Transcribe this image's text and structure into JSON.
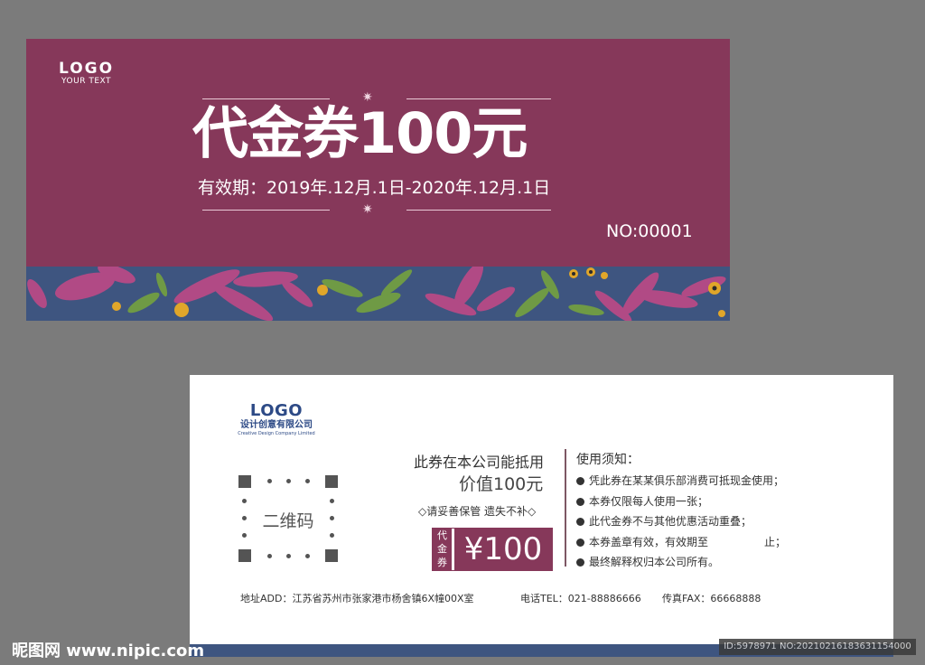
{
  "front": {
    "logo_main": "LOGO",
    "logo_sub": "YOUR TEXT",
    "title": "代金券100元",
    "validity": "有效期：2019年.12月.1日-2020年.12月.1日",
    "serial": "NO:00001",
    "star_icon": "✷",
    "colors": {
      "background": "#86385a",
      "floral_band": "#3e5580"
    }
  },
  "back": {
    "logo_main": "LOGO",
    "logo_cn": "设计创意有限公司",
    "logo_en": "Creative Design Company Limited",
    "qr_label": "二维码",
    "use_text": "此券在本公司能抵用",
    "value_text": "价值100元",
    "keep_text": "◇请妥善保管 遗失不补◇",
    "stamp_tag": "代金券",
    "stamp_amount": "¥100",
    "notice_title": "使用须知：",
    "notices": [
      "凭此券在某某俱乐部消费可抵现金使用；",
      "本券仅限每人使用一张；",
      "此代金券不与其他优惠活动重叠；",
      "本券盖章有效，有效期至",
      "最终解释权归本公司所有。"
    ],
    "notice_4_tail": "止；",
    "address": "地址ADD：江苏省苏州市张家港市杨舍镇6X幢00X室",
    "phone": "电话TEL：021-88886666",
    "fax": "传真FAX：66668888"
  },
  "watermark": {
    "site": "昵图网 www.nipic.com",
    "id": "ID:5978971 NO:20210216183631154000"
  }
}
